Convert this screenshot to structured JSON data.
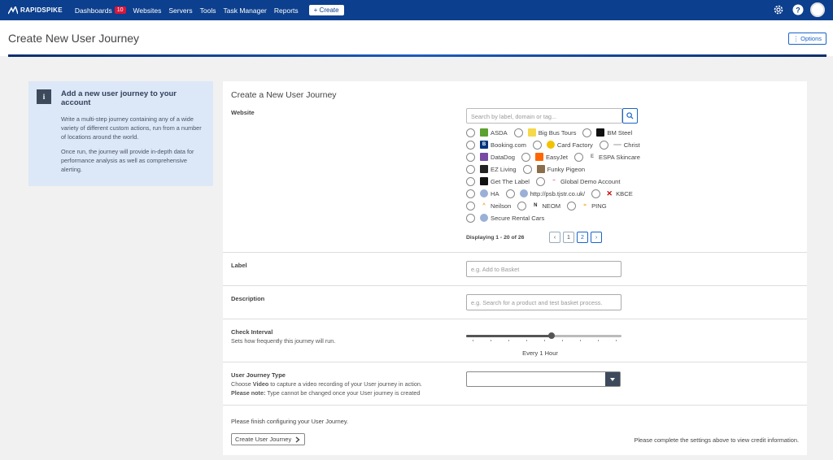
{
  "topnav": {
    "brand": "RAPIDSPIKE",
    "items": [
      {
        "label": "Dashboards",
        "badge": "10"
      },
      {
        "label": "Websites"
      },
      {
        "label": "Servers"
      },
      {
        "label": "Tools"
      },
      {
        "label": "Task Manager"
      },
      {
        "label": "Reports"
      }
    ],
    "create_label": "+ Create",
    "icons": [
      "gear-icon",
      "help-icon",
      "avatar"
    ]
  },
  "header": {
    "title": "Create New User Journey",
    "options_label": "⋮ Options"
  },
  "info": {
    "title": "Add a new user journey to your account",
    "para1": "Write a multi-step journey containing any of a wide variety of different custom actions, run from a number of locations around the world.",
    "para2": "Once run, the journey will provide in-depth data for performance analysis as well as comprehensive alerting."
  },
  "form": {
    "title": "Create a New User Journey",
    "website": {
      "label": "Website",
      "search_placeholder": "Search by label, domain or tag...",
      "options": [
        [
          "ASDA",
          "Big Bus Tours",
          "BM Steel"
        ],
        [
          "Booking.com",
          "Card Factory",
          "Christ"
        ],
        [
          "DataDog",
          "EasyJet",
          "ESPA Skincare"
        ],
        [
          "EZ Living",
          "Funky Pigeon"
        ],
        [
          "Get The Label",
          "Global Demo Account"
        ],
        [
          "HA",
          "",
          "http://psb.tjstr.co.uk/",
          "KBCE"
        ],
        [
          "Neilson",
          "NEOM",
          "PING"
        ],
        [
          "Secure Rental Cars"
        ]
      ],
      "pager_text": "Displaying 1 - 20 of 26",
      "pages": [
        "‹",
        "1",
        "2",
        "›"
      ]
    },
    "label_field": {
      "label": "Label",
      "placeholder": "e.g. Add to Basket"
    },
    "description_field": {
      "label": "Description",
      "placeholder": "e.g. Search for a product and test basket process."
    },
    "interval": {
      "label": "Check Interval",
      "sub": "Sets how frequently this journey will run.",
      "value_text": "Every 1 Hour",
      "position_fraction": 0.55
    },
    "journey_type": {
      "label": "User Journey Type",
      "sub_line1_a": "Choose ",
      "sub_line1_b": "Video",
      "sub_line1_c": " to capture a video recording of your User journey in action.",
      "sub_line2_a": "Please note:",
      "sub_line2_b": " Type cannot be changed once your User journey is created",
      "selected": ""
    },
    "footer_msg": "Please finish configuring your User Journey.",
    "submit_label": "Create User Journey",
    "credit_msg": "Please complete the settings above to view credit information."
  },
  "colors": {
    "nav": "#0c3f8d",
    "accent": "#1a64c8",
    "info_bg": "#dce8f7",
    "badge": "#d9163b"
  }
}
